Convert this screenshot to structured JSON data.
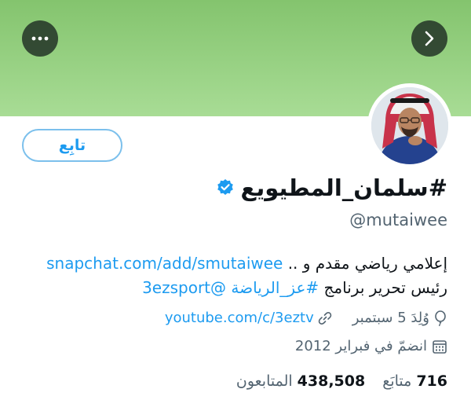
{
  "header": {
    "more_icon": "more-horizontal-icon",
    "forward_icon": "chevron-right-icon",
    "banner_color": "#9bd386"
  },
  "profile": {
    "follow_label": "تابِع",
    "display_name": "#سلمان_المطيويع",
    "verified_icon": "verified-badge-icon",
    "verified_color": "#1d9bf0",
    "handle": "@mutaiwee",
    "bio": {
      "text_start": "إعلامي رياضي مقدم و ..",
      "link1": "snapchat.com/add/smutaiwee",
      "text_mid": "رئيس تحرير برنامج",
      "hashtag": "#عز_الرياضة",
      "mention": "@3ezsport"
    },
    "website": "youtube.com/c/3eztv",
    "birthday": "وُلِدَ 5 سبتمبر",
    "joined": "انضمّ في فبراير 2012",
    "following_count": "716",
    "following_label": "متابَع",
    "followers_count": "438,508",
    "followers_label": "المتابعون"
  },
  "colors": {
    "link": "#1d9bf0",
    "secondary_text": "#536471"
  }
}
